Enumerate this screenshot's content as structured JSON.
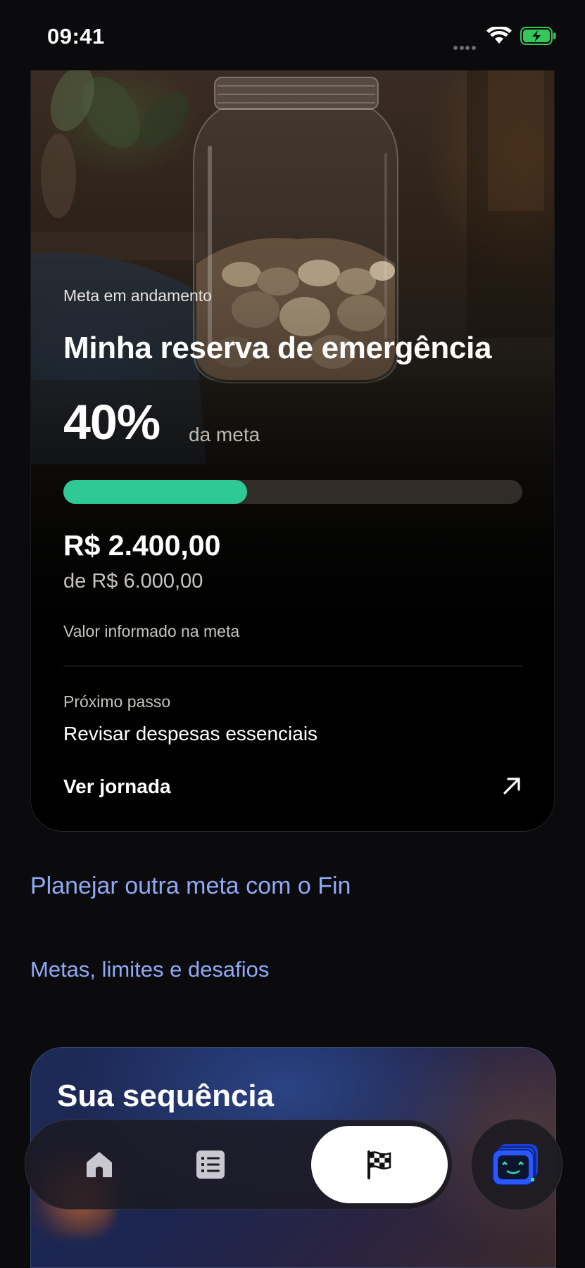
{
  "status_bar": {
    "time": "09:41"
  },
  "goal_card": {
    "status": "Meta em andamento",
    "title": "Minha reserva de emergência",
    "percent_text": "40%",
    "percent_label": "da meta",
    "progress": 0.4,
    "saved_amount": "R$ 2.400,00",
    "target_amount": "de R$ 6.000,00",
    "value_note": "Valor informado na meta",
    "next_step_label": "Próximo passo",
    "next_step_value": "Revisar despesas essenciais",
    "journey_label": "Ver jornada",
    "progress_color": "#2ec995"
  },
  "links": {
    "plan_other_goal": "Planejar outra meta com o Fin",
    "goals_limits_challenges": "Metas, limites e desafios"
  },
  "streak_card": {
    "title": "Sua sequência"
  },
  "bottom_nav": {
    "items": [
      {
        "icon": "home-icon",
        "active": false
      },
      {
        "icon": "list-icon",
        "active": false
      },
      {
        "icon": "flag-icon",
        "active": true
      }
    ],
    "fin_icon": "fin-robot-icon"
  },
  "colors": {
    "accent_link": "#8fa9f5",
    "background": "#0b0b0e"
  }
}
